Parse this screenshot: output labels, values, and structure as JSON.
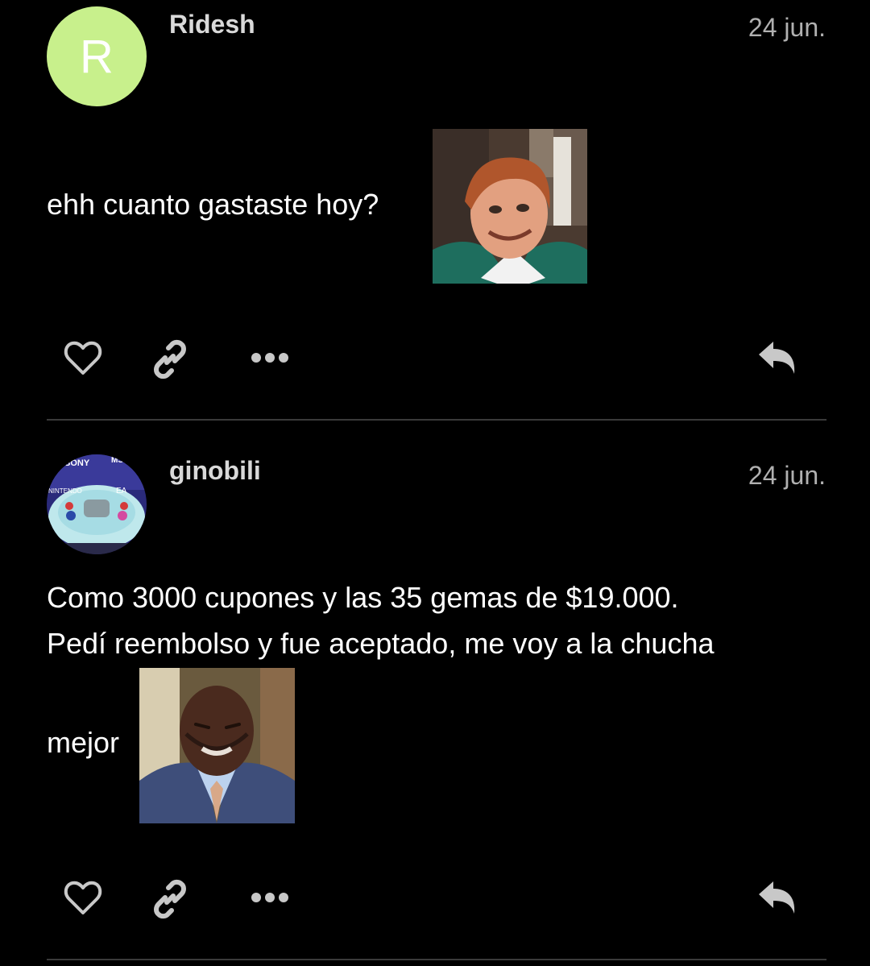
{
  "posts": [
    {
      "username": "Ridesh",
      "avatar_letter": "R",
      "avatar_color": "#c8f08c",
      "date": "24 jun.",
      "text": "ehh cuanto gastaste hoy?",
      "actions": [
        "heart-icon",
        "link-icon",
        "more-icon",
        "reply-icon"
      ]
    },
    {
      "username": "ginobili",
      "avatar_labels": [
        "SONY",
        "MS",
        "NINTENDO",
        "EA"
      ],
      "date": "24 jun.",
      "text_line1": "Como 3000 cupones y las 35 gemas de $19.000.",
      "text_line2": "Pedí reembolso y fue aceptado, me voy a la chucha",
      "text_line3": "mejor",
      "actions": [
        "heart-icon",
        "link-icon",
        "more-icon",
        "reply-icon"
      ]
    }
  ],
  "colors": {
    "background": "#000000",
    "text": "#ffffff",
    "muted": "#b0b0b0",
    "divider": "#3a3a3a",
    "icon": "#c8c8c8"
  }
}
